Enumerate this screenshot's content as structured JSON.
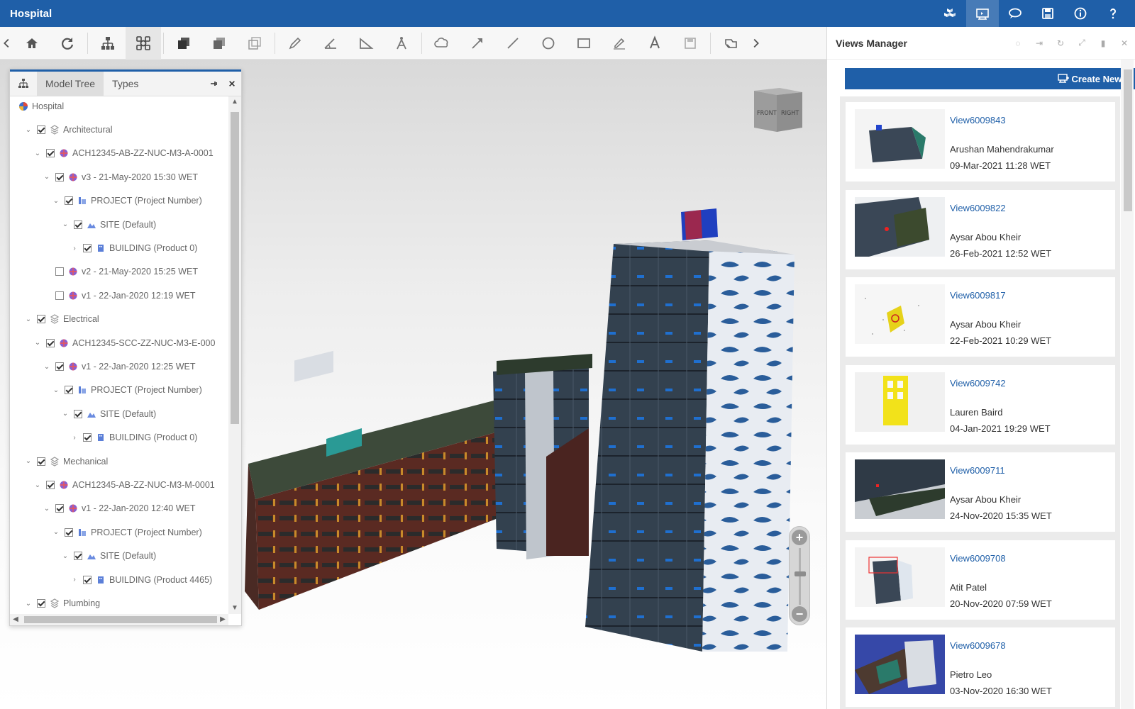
{
  "app": {
    "title": "Hospital"
  },
  "titlebar_icons": [
    "models-icon",
    "views-icon",
    "comments-icon",
    "save-icon",
    "info-icon",
    "help-icon"
  ],
  "toolbar": {
    "tools": [
      "back-chevron-icon",
      "home-icon",
      "refresh-icon",
      "hierarchy-icon",
      "explode-icon",
      "cube-solid-icon",
      "cube-shaded-icon",
      "cube-wire-icon",
      "pencil-icon",
      "angle-icon",
      "area-icon",
      "compass-icon",
      "cloud-icon",
      "arrow-icon",
      "line-icon",
      "circle-icon",
      "rectangle-icon",
      "marker-icon",
      "text-icon",
      "save-markup-icon",
      "stamp-icon",
      "forward-chevron-icon"
    ]
  },
  "model_tree": {
    "tabs": [
      {
        "label": "Model Tree"
      },
      {
        "label": "Types"
      }
    ],
    "root": "Hospital",
    "rows": [
      {
        "label": "Architectural",
        "level": 1,
        "expanded": true,
        "checked": true,
        "icon": "layer-icon"
      },
      {
        "label": "ACH12345-AB-ZZ-NUC-M3-A-0001",
        "level": 2,
        "expanded": true,
        "checked": true,
        "icon": "model-file-icon"
      },
      {
        "label": "v3 - 21-May-2020 15:30 WET",
        "level": 3,
        "expanded": true,
        "checked": true,
        "icon": "version-icon"
      },
      {
        "label": "PROJECT (Project Number)",
        "level": 4,
        "expanded": true,
        "checked": true,
        "icon": "project-icon"
      },
      {
        "label": "SITE (Default)",
        "level": 5,
        "expanded": true,
        "checked": true,
        "icon": "site-icon"
      },
      {
        "label": "BUILDING (Product 0)",
        "level": 6,
        "expanded": false,
        "checked": true,
        "icon": "building-icon"
      },
      {
        "label": "v2 - 21-May-2020 15:25 WET",
        "level": 3,
        "expanded": null,
        "checked": false,
        "icon": "version-icon"
      },
      {
        "label": "v1 - 22-Jan-2020 12:19 WET",
        "level": 3,
        "expanded": null,
        "checked": false,
        "icon": "version-icon"
      },
      {
        "label": "Electrical",
        "level": 1,
        "expanded": true,
        "checked": true,
        "icon": "layer-icon"
      },
      {
        "label": "ACH12345-SCC-ZZ-NUC-M3-E-000",
        "level": 2,
        "expanded": true,
        "checked": true,
        "icon": "model-file-icon"
      },
      {
        "label": "v1 - 22-Jan-2020 12:25 WET",
        "level": 3,
        "expanded": true,
        "checked": true,
        "icon": "version-icon"
      },
      {
        "label": "PROJECT (Project Number)",
        "level": 4,
        "expanded": true,
        "checked": true,
        "icon": "project-icon"
      },
      {
        "label": "SITE (Default)",
        "level": 5,
        "expanded": true,
        "checked": true,
        "icon": "site-icon"
      },
      {
        "label": "BUILDING (Product 0)",
        "level": 6,
        "expanded": false,
        "checked": true,
        "icon": "building-icon"
      },
      {
        "label": "Mechanical",
        "level": 1,
        "expanded": true,
        "checked": true,
        "icon": "layer-icon"
      },
      {
        "label": "ACH12345-AB-ZZ-NUC-M3-M-0001",
        "level": 2,
        "expanded": true,
        "checked": true,
        "icon": "model-file-icon"
      },
      {
        "label": "v1 - 22-Jan-2020 12:40 WET",
        "level": 3,
        "expanded": true,
        "checked": true,
        "icon": "version-icon"
      },
      {
        "label": "PROJECT (Project Number)",
        "level": 4,
        "expanded": true,
        "checked": true,
        "icon": "project-icon"
      },
      {
        "label": "SITE (Default)",
        "level": 5,
        "expanded": true,
        "checked": true,
        "icon": "site-icon"
      },
      {
        "label": "BUILDING (Product 4465)",
        "level": 6,
        "expanded": false,
        "checked": true,
        "icon": "building-icon"
      },
      {
        "label": "Plumbing",
        "level": 1,
        "expanded": true,
        "checked": true,
        "icon": "layer-icon"
      }
    ]
  },
  "viewcube": {
    "front": "FRONT",
    "right": "RIGHT"
  },
  "zoom": {
    "plus": "+",
    "minus": "−",
    "level": 0.55
  },
  "views_manager": {
    "title": "Views Manager",
    "create_label": "Create New Vi",
    "views": [
      {
        "name": "View6009843",
        "author": "Arushan Mahendrakumar",
        "date": "09-Mar-2021 11:28 WET"
      },
      {
        "name": "View6009822",
        "author": "Aysar Abou Kheir",
        "date": "26-Feb-2021 12:52 WET"
      },
      {
        "name": "View6009817",
        "author": "Aysar Abou Kheir",
        "date": "22-Feb-2021 10:29 WET"
      },
      {
        "name": "View6009742",
        "author": "Lauren Baird",
        "date": "04-Jan-2021 19:29 WET"
      },
      {
        "name": "View6009711",
        "author": "Aysar Abou Kheir",
        "date": "24-Nov-2020 15:35 WET"
      },
      {
        "name": "View6009708",
        "author": "Atit Patel",
        "date": "20-Nov-2020 07:59 WET"
      },
      {
        "name": "View6009678",
        "author": "Pietro Leo",
        "date": "03-Nov-2020 16:30 WET"
      }
    ]
  },
  "colors": {
    "brand": "#1f5fa8",
    "brick": "#5a2a22",
    "glass": "#2f3c4d",
    "panel_white": "#e9edf3",
    "panel_blue": "#2a5d9a"
  }
}
